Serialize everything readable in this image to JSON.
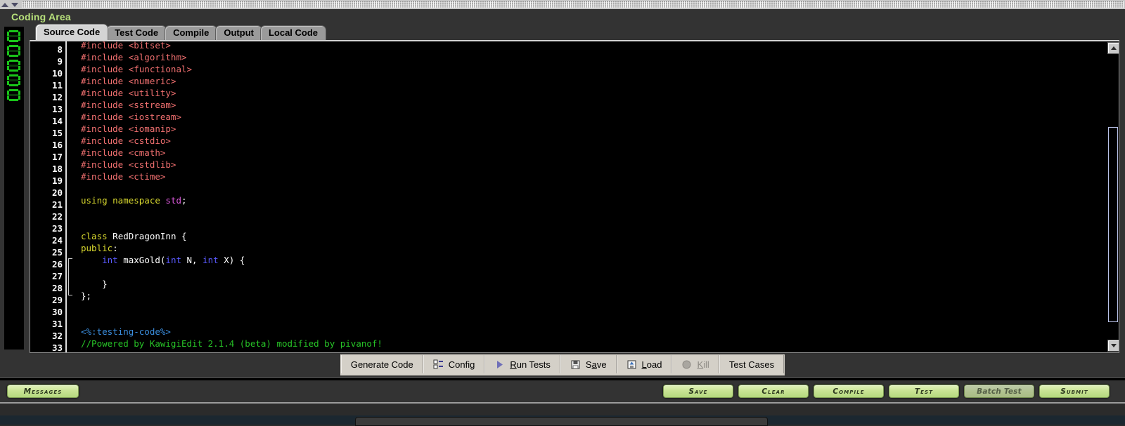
{
  "window": {
    "panel_title": "Coding Area",
    "collapse_up_icon": "triangle-up-icon",
    "collapse_down_icon": "triangle-down-icon",
    "drag_handle": "drag-grip"
  },
  "timer": {
    "label": "led-timer",
    "digits": [
      "0",
      "0",
      "0",
      "0",
      "0"
    ]
  },
  "tabs": [
    {
      "label": "Source Code",
      "active": true
    },
    {
      "label": "Test Code",
      "active": false
    },
    {
      "label": "Compile",
      "active": false
    },
    {
      "label": "Output",
      "active": false
    },
    {
      "label": "Local Code",
      "active": false
    }
  ],
  "editor": {
    "first_visible_line": 8,
    "gutter": [
      "8",
      "9",
      "10",
      "11",
      "12",
      "13",
      "14",
      "15",
      "16",
      "17",
      "18",
      "19",
      "20",
      "21",
      "22",
      "23",
      "24",
      "25",
      "26",
      "27",
      "28",
      "29",
      "30",
      "31",
      "32",
      "33"
    ],
    "lines": [
      {
        "n": "8",
        "text": "#include <bitset>",
        "kind": "include",
        "clipped": true
      },
      {
        "n": "9",
        "text": "#include <algorithm>",
        "kind": "include"
      },
      {
        "n": "10",
        "text": "#include <functional>",
        "kind": "include"
      },
      {
        "n": "11",
        "text": "#include <numeric>",
        "kind": "include"
      },
      {
        "n": "12",
        "text": "#include <utility>",
        "kind": "include"
      },
      {
        "n": "13",
        "text": "#include <sstream>",
        "kind": "include"
      },
      {
        "n": "14",
        "text": "#include <iostream>",
        "kind": "include"
      },
      {
        "n": "15",
        "text": "#include <iomanip>",
        "kind": "include"
      },
      {
        "n": "16",
        "text": "#include <cstdio>",
        "kind": "include"
      },
      {
        "n": "17",
        "text": "#include <cmath>",
        "kind": "include"
      },
      {
        "n": "18",
        "text": "#include <cstdlib>",
        "kind": "include"
      },
      {
        "n": "19",
        "text": "#include <ctime>",
        "kind": "include"
      },
      {
        "n": "20",
        "text": "",
        "kind": "blank"
      },
      {
        "n": "21",
        "text": "using namespace std;",
        "kind": "using"
      },
      {
        "n": "22",
        "text": "",
        "kind": "blank"
      },
      {
        "n": "23",
        "text": "",
        "kind": "blank"
      },
      {
        "n": "24",
        "text": "class RedDragonInn {",
        "kind": "class"
      },
      {
        "n": "25",
        "text": "public:",
        "kind": "access"
      },
      {
        "n": "26",
        "text": "    int maxGold(int N, int X) {",
        "kind": "method"
      },
      {
        "n": "27",
        "text": "",
        "kind": "blank"
      },
      {
        "n": "28",
        "text": "    }",
        "kind": "plain"
      },
      {
        "n": "29",
        "text": "};",
        "kind": "plain"
      },
      {
        "n": "30",
        "text": "",
        "kind": "blank"
      },
      {
        "n": "31",
        "text": "",
        "kind": "blank"
      },
      {
        "n": "32",
        "text": "<%:testing-code%>",
        "kind": "tag"
      },
      {
        "n": "33",
        "text": "//Powered by KawigiEdit 2.1.4 (beta) modified by pivanof!",
        "kind": "comment"
      }
    ],
    "class_name": "RedDragonInn",
    "method_signature": "int maxGold(int N, int X) {",
    "scrollbar": {
      "up_icon": "scroll-up-arrow-icon",
      "down_icon": "scroll-down-arrow-icon"
    }
  },
  "toolbar": {
    "buttons": [
      {
        "label": "Generate Code",
        "icon": null,
        "disabled": false,
        "mnemonic": ""
      },
      {
        "label": "Config",
        "icon": "config-icon",
        "disabled": false,
        "mnemonic": ""
      },
      {
        "label": "Run Tests",
        "icon": "play-icon",
        "disabled": false,
        "mnemonic": "R"
      },
      {
        "label": "Save",
        "icon": "floppy-icon",
        "disabled": false,
        "mnemonic": "a"
      },
      {
        "label": "Load",
        "icon": "load-icon",
        "disabled": false,
        "mnemonic": "L"
      },
      {
        "label": "Kill",
        "icon": "stop-icon",
        "disabled": true,
        "mnemonic": "K"
      },
      {
        "label": "Test Cases",
        "icon": null,
        "disabled": false,
        "mnemonic": ""
      }
    ]
  },
  "bottom_bar": {
    "messages_label": "Messages",
    "actions": [
      {
        "label": "Save",
        "muted": false
      },
      {
        "label": "Clear",
        "muted": false
      },
      {
        "label": "Compile",
        "muted": false
      },
      {
        "label": "Test",
        "muted": false
      },
      {
        "label": "Batch Test",
        "muted": true
      },
      {
        "label": "Submit",
        "muted": false
      }
    ]
  },
  "colors": {
    "panel_bg": "#333333",
    "title_green": "#b7e07b",
    "editor_bg": "#000000",
    "include_red": "#ef6f6f",
    "keyword_yellow": "#d8d82e",
    "type_blue": "#5a5aff",
    "std_magenta": "#dd5add",
    "tag_blue": "#3b8fe0",
    "comment_green": "#27c427",
    "led_green": "#19c419",
    "button_face": "#d4d0c8",
    "glow_green": "#c9e495"
  }
}
